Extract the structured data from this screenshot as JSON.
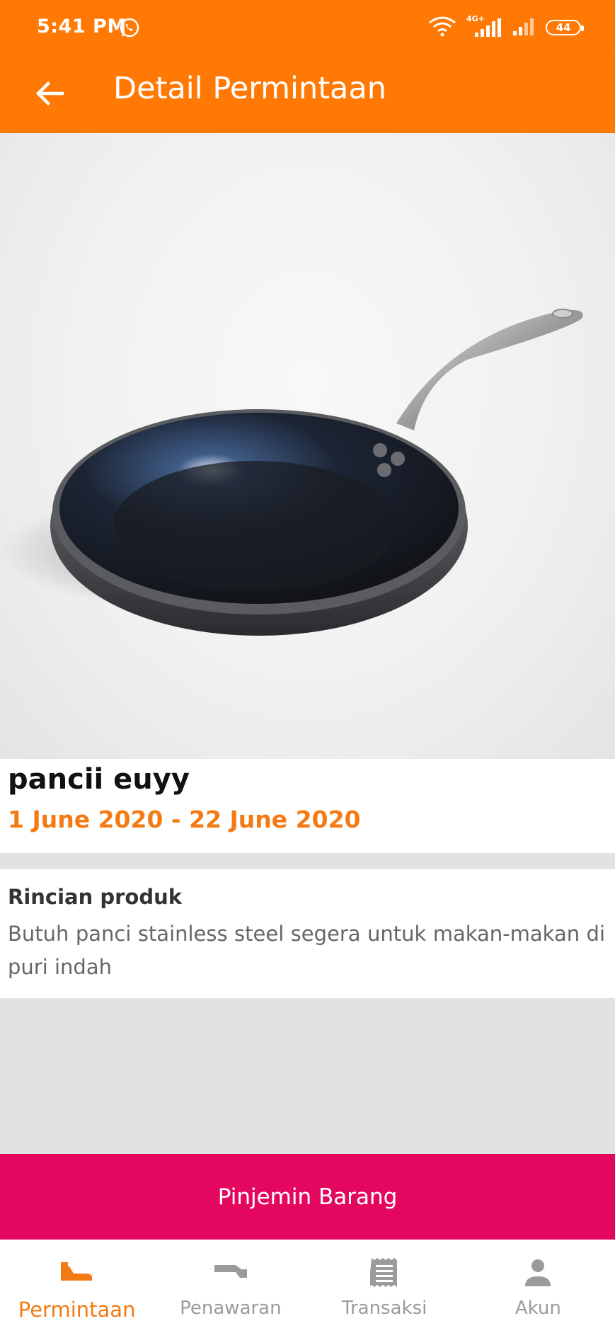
{
  "status_bar": {
    "time": "5:41 PM",
    "network_label": "4G+",
    "battery": "44",
    "icons": [
      "whatsapp-icon",
      "wifi-icon",
      "signal-4g-icon",
      "signal-icon",
      "battery-icon"
    ]
  },
  "app_bar": {
    "title": "Detail Permintaan",
    "back_icon": "arrow-left-icon"
  },
  "product": {
    "image": "frying-pan-photo",
    "name": "pancii euyy",
    "date_range": "1 June 2020 - 22 June 2020"
  },
  "details": {
    "heading": "Rincian produk",
    "description": "Butuh panci stainless steel segera untuk makan-makan di puri indah"
  },
  "action": {
    "label": "Pinjemin Barang"
  },
  "bottom_nav": {
    "items": [
      {
        "label": "Permintaan",
        "icon": "request-hand-icon",
        "active": true
      },
      {
        "label": "Penawaran",
        "icon": "offer-hand-icon",
        "active": false
      },
      {
        "label": "Transaksi",
        "icon": "receipt-icon",
        "active": false
      },
      {
        "label": "Akun",
        "icon": "person-icon",
        "active": false
      }
    ]
  },
  "colors": {
    "primary": "#ff7904",
    "accent_date": "#f47a14",
    "action_button": "#e4075f",
    "inactive_nav": "#9b9b9b"
  }
}
